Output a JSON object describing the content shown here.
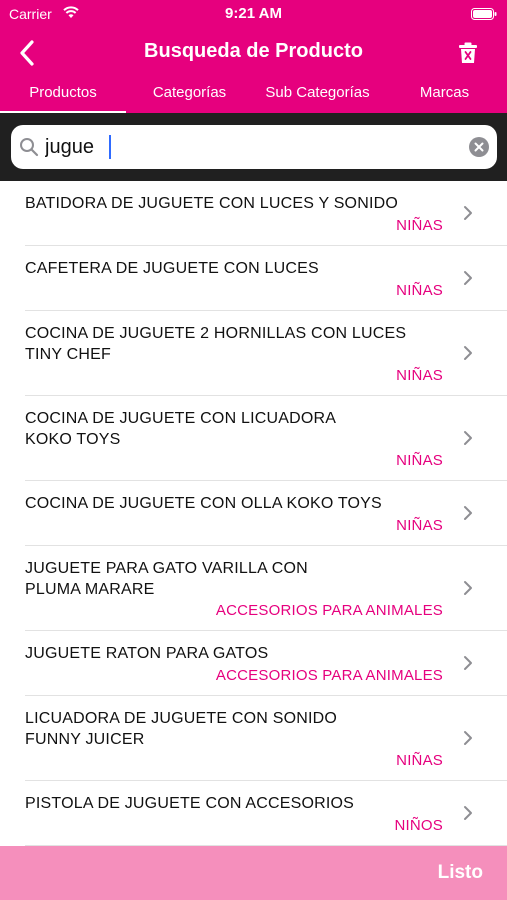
{
  "status_bar": {
    "carrier": "Carrier",
    "time": "9:21 AM"
  },
  "navbar": {
    "title": "Busqueda de Producto",
    "back_icon": "chevron-left-icon",
    "trash_icon": "trash-icon"
  },
  "tabs": [
    {
      "label": "Productos",
      "selected": true
    },
    {
      "label": "Categorías",
      "selected": false
    },
    {
      "label": "Sub Categorías",
      "selected": false
    },
    {
      "label": "Marcas",
      "selected": false
    }
  ],
  "search": {
    "value": "jugue"
  },
  "results": [
    {
      "line1": "BATIDORA DE JUGUETE CON LUCES Y SONIDO",
      "line2": "",
      "category": "NIÑAS"
    },
    {
      "line1": "CAFETERA DE JUGUETE CON LUCES",
      "line2": "",
      "category": "NIÑAS"
    },
    {
      "line1": "COCINA DE JUGUETE 2 HORNILLAS CON LUCES",
      "line2": "TINY CHEF",
      "category": "NIÑAS"
    },
    {
      "line1": "COCINA DE JUGUETE CON LICUADORA",
      "line2": "KOKO TOYS",
      "category": "NIÑAS"
    },
    {
      "line1": "COCINA DE JUGUETE CON OLLA KOKO TOYS",
      "line2": "",
      "category": "NIÑAS"
    },
    {
      "line1": "JUGUETE PARA GATO VARILLA CON",
      "line2": "PLUMA MARARE",
      "category": "ACCESORIOS PARA ANIMALES"
    },
    {
      "line1": "JUGUETE RATON PARA GATOS",
      "line2": "",
      "category": "ACCESORIOS PARA ANIMALES"
    },
    {
      "line1": "LICUADORA DE JUGUETE CON SONIDO",
      "line2": "FUNNY JUICER",
      "category": "NIÑAS"
    },
    {
      "line1": "PISTOLA DE JUGUETE CON ACCESORIOS",
      "line2": "",
      "category": "NIÑOS"
    }
  ],
  "footer": {
    "done_label": "Listo"
  },
  "colors": {
    "brand": "#e6007e",
    "footer": "#f58fbc",
    "search_bg": "#202020"
  }
}
